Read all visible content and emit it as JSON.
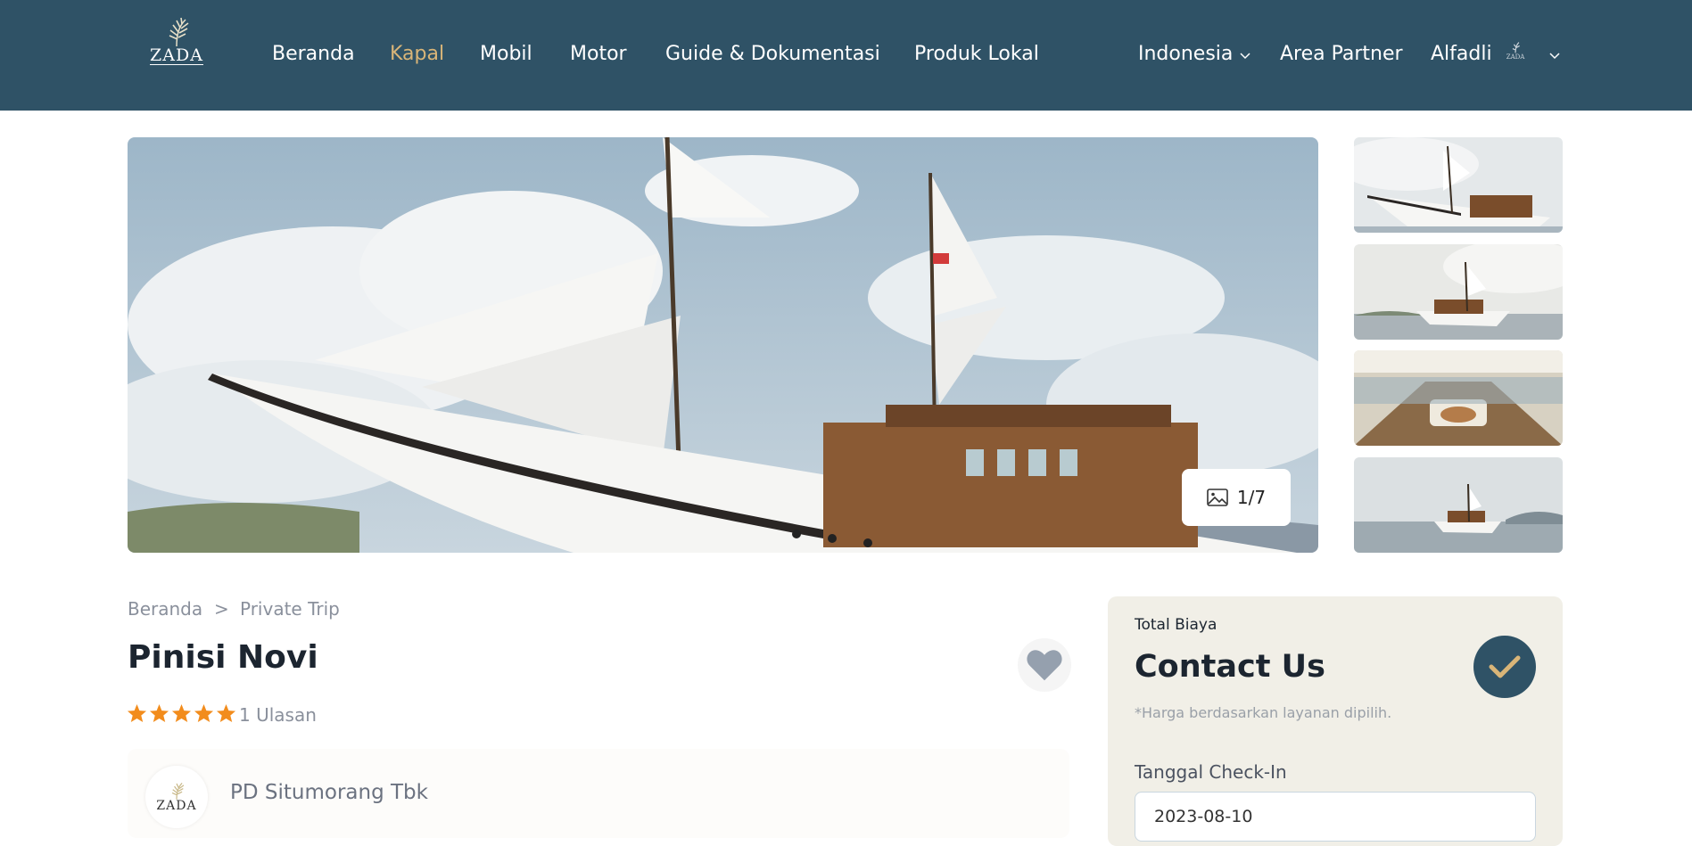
{
  "brand": {
    "logo_text": "ZADA",
    "primary_color": "#2f5266",
    "accent_color": "#d9b578"
  },
  "nav": {
    "items": [
      {
        "label": "Beranda",
        "active": false
      },
      {
        "label": "Kapal",
        "active": true
      },
      {
        "label": "Mobil",
        "active": false
      },
      {
        "label": "Motor",
        "active": false
      },
      {
        "label": "Guide & Dokumentasi",
        "active": false
      },
      {
        "label": "Produk Lokal",
        "active": false
      }
    ],
    "language": "Indonesia",
    "partner": "Area Partner",
    "user": "Alfadli"
  },
  "gallery": {
    "counter": "1/7",
    "thumbnails": [
      "boat-side-view",
      "boat-at-sea",
      "deck-lounge",
      "boat-distance"
    ]
  },
  "breadcrumb": {
    "items": [
      "Beranda",
      "Private Trip"
    ],
    "separator": ">"
  },
  "listing": {
    "title": "Pinisi Novi",
    "rating": 5,
    "reviews": "1 Ulasan",
    "vendor": "PD Situmorang Tbk"
  },
  "price_panel": {
    "label": "Total Biaya",
    "price": "Contact Us",
    "note": "*Harga berdasarkan layanan dipilih.",
    "checkin_label": "Tanggal Check-In",
    "checkin_value": "2023-08-10"
  }
}
